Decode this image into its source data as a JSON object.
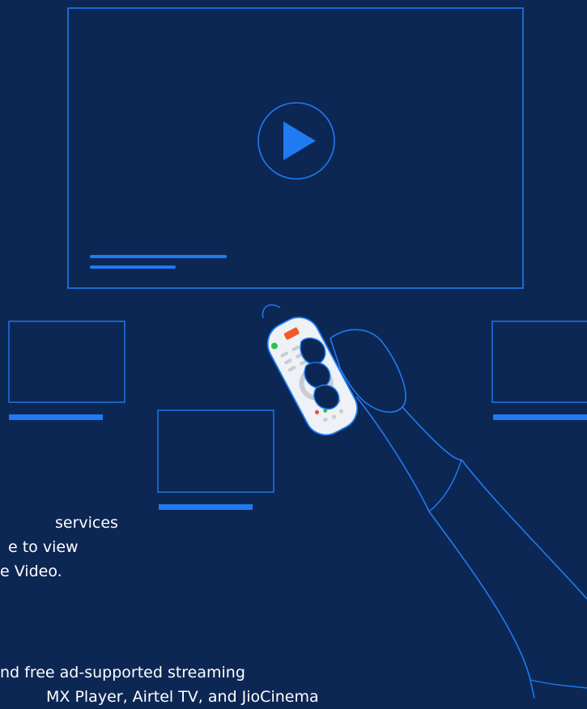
{
  "colors": {
    "background": "#0d2754",
    "accent": "#1f7bf2",
    "text": "#ffffff",
    "remote_body": "#eef1f5"
  },
  "illustration": {
    "icon": "play-icon"
  },
  "text_block_1": {
    "line1": "services",
    "line2": "e to view",
    "line3": "e Video."
  },
  "text_block_2": {
    "line1": "nd free ad-supported streaming",
    "line2": "MX Player, Airtel TV, and JioCinema"
  }
}
